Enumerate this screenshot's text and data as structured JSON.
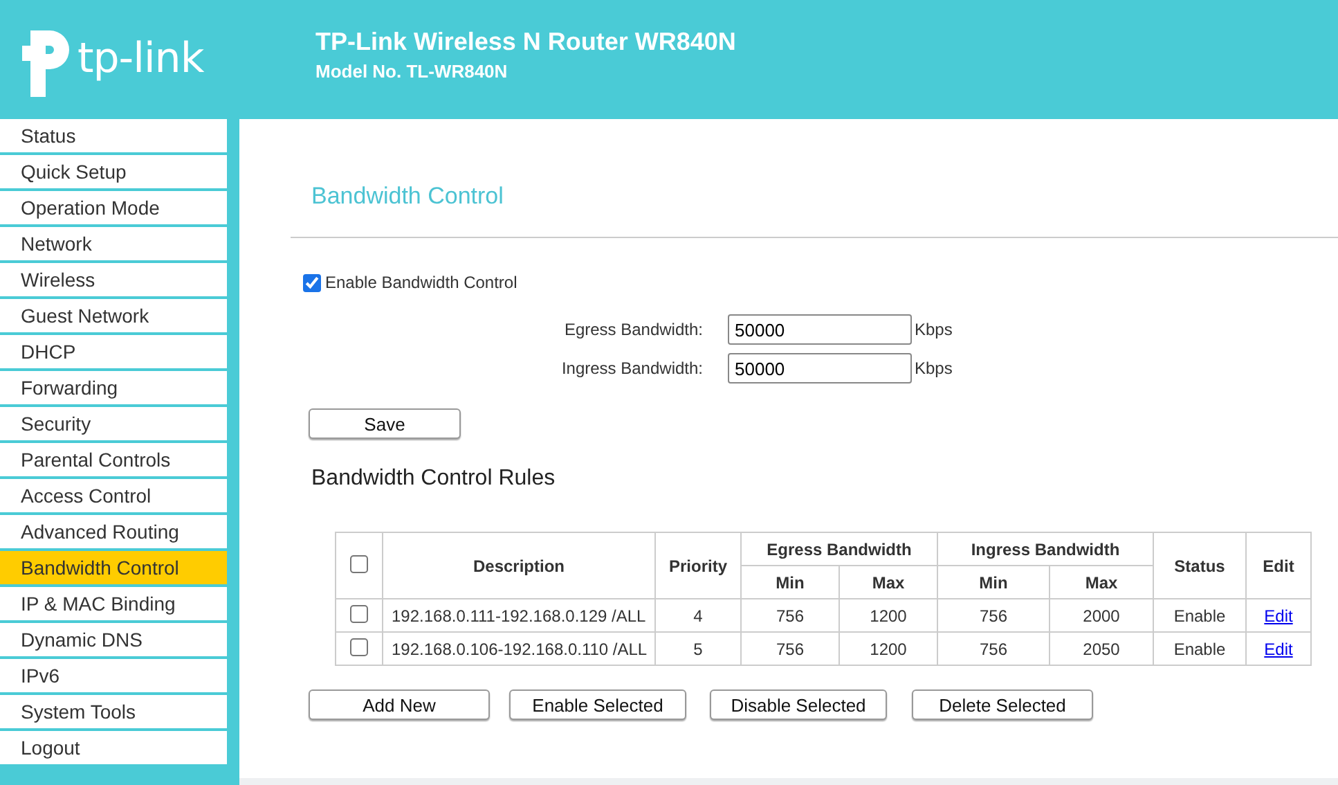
{
  "header": {
    "logo_text": "tp-link",
    "title": "TP-Link Wireless N Router WR840N",
    "subtitle": "Model No. TL-WR840N"
  },
  "sidebar": {
    "items": [
      {
        "label": "Status",
        "selected": false
      },
      {
        "label": "Quick Setup",
        "selected": false
      },
      {
        "label": "Operation Mode",
        "selected": false
      },
      {
        "label": "Network",
        "selected": false
      },
      {
        "label": "Wireless",
        "selected": false
      },
      {
        "label": "Guest Network",
        "selected": false
      },
      {
        "label": "DHCP",
        "selected": false
      },
      {
        "label": "Forwarding",
        "selected": false
      },
      {
        "label": "Security",
        "selected": false
      },
      {
        "label": "Parental Controls",
        "selected": false
      },
      {
        "label": "Access Control",
        "selected": false
      },
      {
        "label": "Advanced Routing",
        "selected": false
      },
      {
        "label": "Bandwidth Control",
        "selected": true
      },
      {
        "label": "IP & MAC Binding",
        "selected": false
      },
      {
        "label": "Dynamic DNS",
        "selected": false
      },
      {
        "label": "IPv6",
        "selected": false
      },
      {
        "label": "System Tools",
        "selected": false
      },
      {
        "label": "Logout",
        "selected": false
      }
    ]
  },
  "page": {
    "title": "Bandwidth Control",
    "enable": {
      "label": "Enable Bandwidth Control",
      "checked": true
    },
    "fields": [
      {
        "label": "Egress Bandwidth:",
        "value": "50000",
        "unit": "Kbps"
      },
      {
        "label": "Ingress Bandwidth:",
        "value": "50000",
        "unit": "Kbps"
      }
    ],
    "save_button": "Save",
    "rules": {
      "title": "Bandwidth Control Rules",
      "select_all_checked": false,
      "columns": {
        "description": "Description",
        "priority": "Priority",
        "egress": "Egress Bandwidth",
        "ingress": "Ingress Bandwidth",
        "min_1": "Min",
        "max_1": "Max",
        "min_2": "Min",
        "max_2": "Max",
        "status": "Status",
        "edit": "Edit"
      },
      "rows": [
        {
          "selected": false,
          "description": "192.168.0.111-192.168.0.129 /ALL",
          "priority": "4",
          "egress_min": "756",
          "egress_max": "1200",
          "ingress_min": "756",
          "ingress_max": "2000",
          "status": "Enable",
          "edit": "Edit"
        },
        {
          "selected": false,
          "description": "192.168.0.106-192.168.0.110 /ALL",
          "priority": "5",
          "egress_min": "756",
          "egress_max": "1200",
          "ingress_min": "756",
          "ingress_max": "2050",
          "status": "Enable",
          "edit": "Edit"
        }
      ],
      "buttons": [
        "Add New",
        "Enable Selected",
        "Disable Selected",
        "Delete Selected"
      ]
    }
  }
}
